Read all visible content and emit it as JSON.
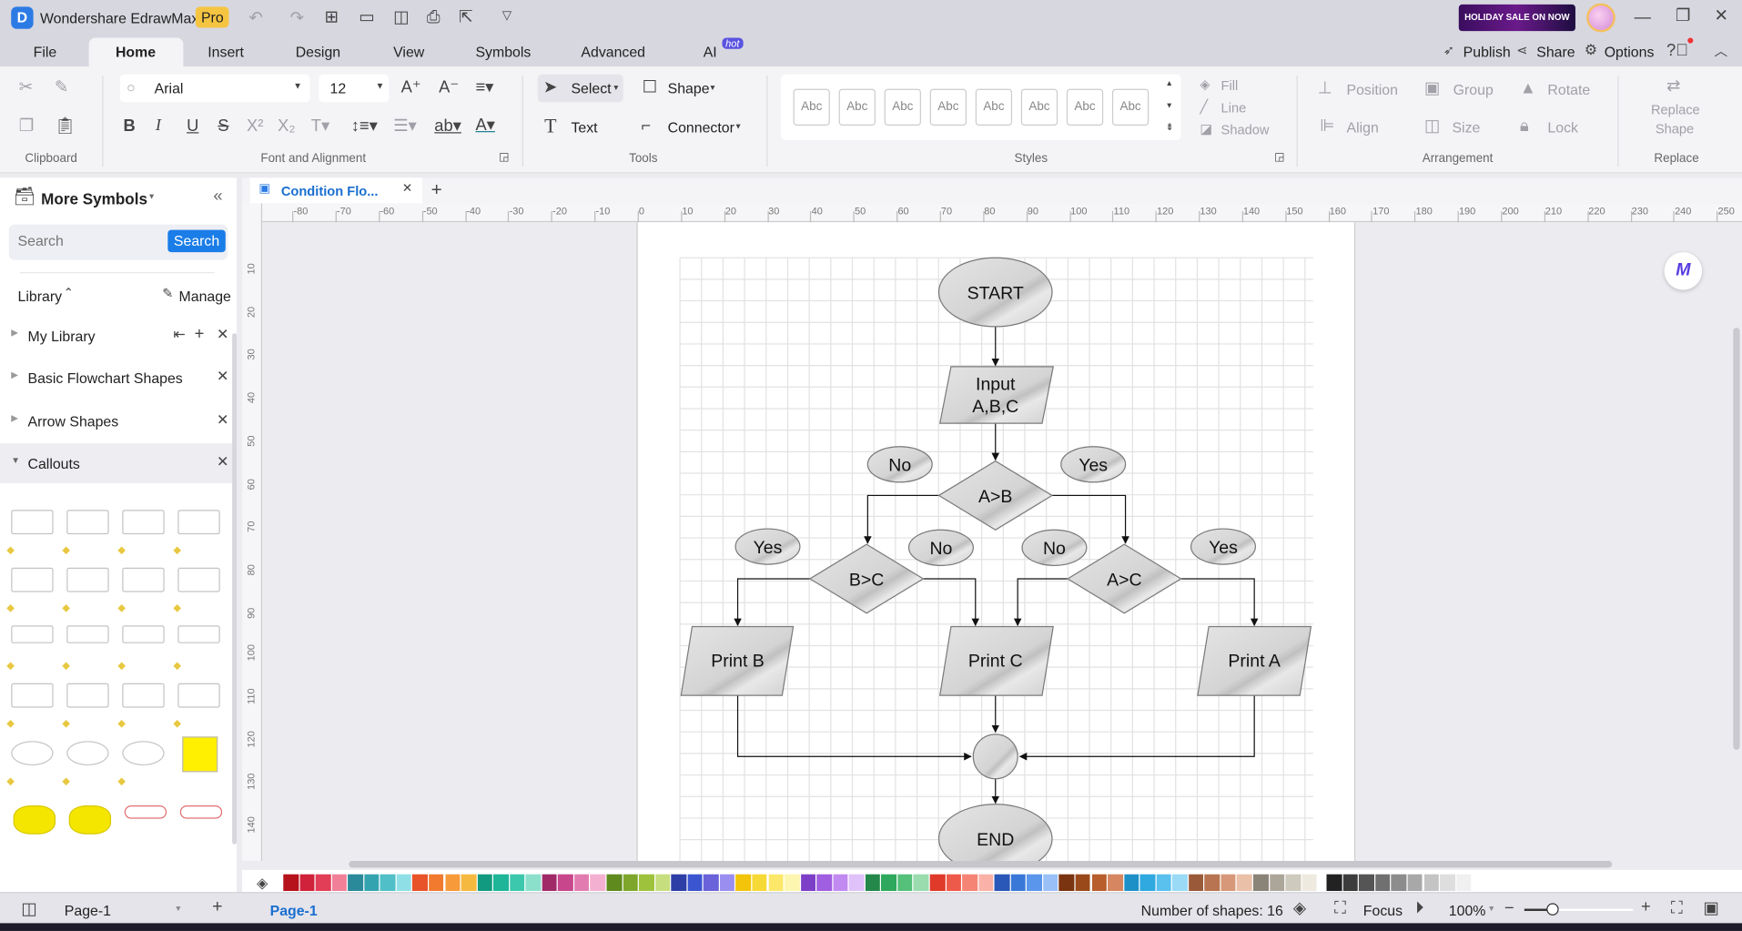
{
  "app": {
    "title": "Wondershare EdrawMax",
    "badge": "Pro",
    "promo": "HOLIDAY SALE ON NOW"
  },
  "menu_tabs": [
    {
      "label": "File"
    },
    {
      "label": "Home",
      "active": true
    },
    {
      "label": "Insert"
    },
    {
      "label": "Design"
    },
    {
      "label": "View"
    },
    {
      "label": "Symbols"
    },
    {
      "label": "Advanced"
    },
    {
      "label": "AI",
      "badge": "hot"
    }
  ],
  "top_actions": {
    "publish": "Publish",
    "share": "Share",
    "options": "Options"
  },
  "ribbon": {
    "clipboard": {
      "label": "Clipboard"
    },
    "font": {
      "label": "Font and Alignment",
      "family": "Arial",
      "size": "12"
    },
    "tools": {
      "label": "Tools",
      "select": "Select",
      "shape": "Shape",
      "text": "Text",
      "connector": "Connector"
    },
    "styles": {
      "label": "Styles",
      "swatch": "Abc",
      "fill": "Fill",
      "line": "Line",
      "shadow": "Shadow"
    },
    "arrangement": {
      "label": "Arrangement",
      "position": "Position",
      "group": "Group",
      "rotate": "Rotate",
      "align": "Align",
      "size": "Size",
      "lock": "Lock"
    },
    "replace": {
      "label": "Replace",
      "button_line1": "Replace",
      "button_line2": "Shape"
    }
  },
  "sidebar": {
    "title": "More Symbols",
    "search_placeholder": "Search",
    "search_button": "Search",
    "library_label": "Library",
    "manage": "Manage",
    "libraries": [
      {
        "label": "My Library"
      },
      {
        "label": "Basic Flowchart Shapes"
      },
      {
        "label": "Arrow Shapes"
      },
      {
        "label": "Callouts",
        "expanded": true
      }
    ]
  },
  "document_tab": {
    "title": "Condition Flo..."
  },
  "rulers": {
    "horizontal": [
      "-80",
      "-70",
      "-60",
      "-50",
      "-40",
      "-30",
      "-20",
      "-10",
      "0",
      "10",
      "20",
      "30",
      "40",
      "50",
      "60",
      "70",
      "80",
      "90",
      "100",
      "110",
      "120",
      "130",
      "140",
      "150",
      "160",
      "170",
      "180",
      "190",
      "200",
      "210",
      "220",
      "230",
      "240",
      "250"
    ],
    "vertical": [
      "10",
      "20",
      "30",
      "40",
      "50",
      "60",
      "70",
      "80",
      "90",
      "100",
      "110",
      "120",
      "130",
      "140"
    ]
  },
  "diagram": {
    "start": "START",
    "input_line1": "Input",
    "input_line2": "A,B,C",
    "d1": "A>B",
    "d2": "B>C",
    "d3": "A>C",
    "print_b": "Print B",
    "print_c": "Print C",
    "print_a": "Print A",
    "end": "END",
    "labels": {
      "d1_no": "No",
      "d1_yes": "Yes",
      "d2_yes": "Yes",
      "d2_no": "No",
      "d3_no": "No",
      "d3_yes": "Yes"
    }
  },
  "palette": [
    "#b5121b",
    "#d0223a",
    "#e23e57",
    "#f08098",
    "#2a8a9a",
    "#34a3b0",
    "#50bfc8",
    "#8fe0e6",
    "#e8532a",
    "#f27a2f",
    "#f79a3a",
    "#f5b940",
    "#129a80",
    "#1eb598",
    "#3cc8ac",
    "#8be0cc",
    "#a02a68",
    "#c8468c",
    "#e27cb0",
    "#f4b0d0",
    "#5f8a1e",
    "#7ea62a",
    "#9ec23c",
    "#c6de7e",
    "#2d3fa6",
    "#3b55d0",
    "#6a62d8",
    "#9a8ef0",
    "#f2c40a",
    "#f7d935",
    "#fbe86a",
    "#fdf6b0",
    "#7e3fc8",
    "#a05ee0",
    "#c08af0",
    "#e0c2fa",
    "#23884a",
    "#2ea85c",
    "#54c07a",
    "#9adcae",
    "#e03a2a",
    "#ee5a4a",
    "#f58474",
    "#fab2a8",
    "#2a58b8",
    "#3a78d8",
    "#5a96ec",
    "#9ac0f8",
    "#7a3410",
    "#9a4a1a",
    "#b85e2c",
    "#d68660",
    "#1e90c8",
    "#30a8e0",
    "#5ac0ee",
    "#9adaf6",
    "#9a5a3a",
    "#b87450",
    "#d69878",
    "#eac0a8",
    "#8a8478",
    "#aca69a",
    "#cecabe",
    "#eeeae0",
    "#222222",
    "#3c3c3c",
    "#555555",
    "#707070",
    "#8c8c8c",
    "#a8a8a8",
    "#c4c4c4",
    "#dedede",
    "#f0f0f0"
  ],
  "status": {
    "page_select": "Page-1",
    "page_tab": "Page-1",
    "shapes": "Number of shapes: 16",
    "focus": "Focus",
    "zoom": "100%",
    "zoom_level": 100
  }
}
